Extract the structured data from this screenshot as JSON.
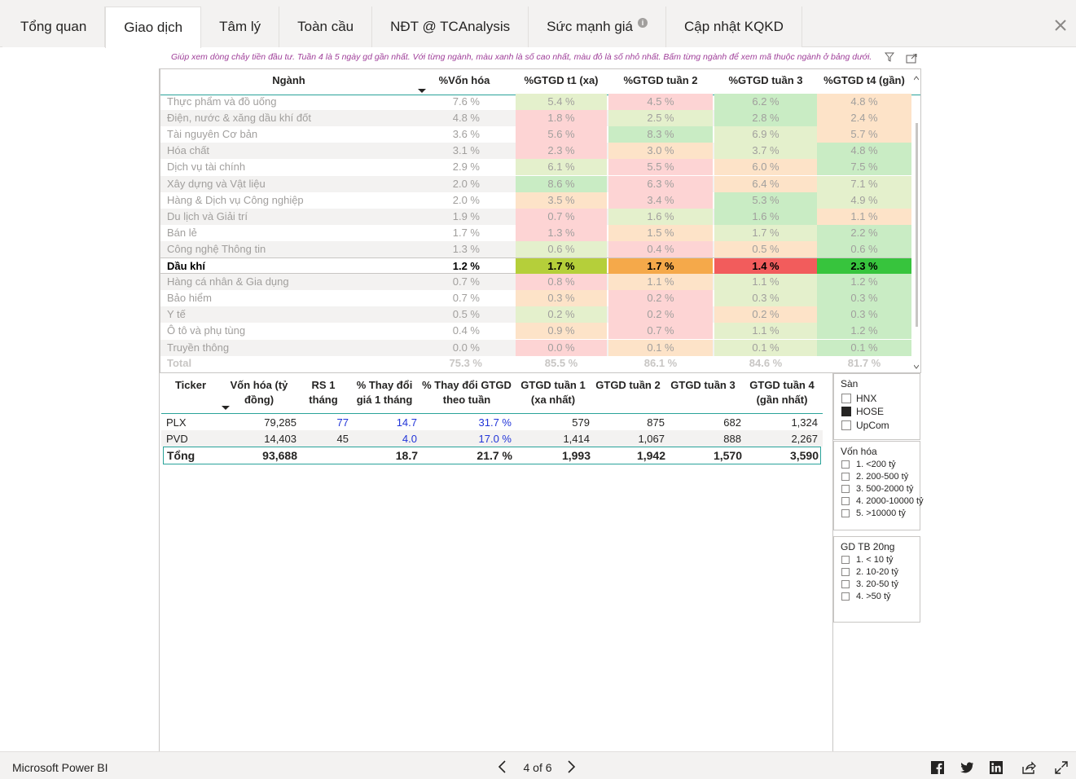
{
  "tabs": [
    {
      "label": "Tổng quan"
    },
    {
      "label": "Giao dịch"
    },
    {
      "label": "Tâm lý"
    },
    {
      "label": "Toàn cầu"
    },
    {
      "label": "NĐT @ TCAnalysis"
    },
    {
      "label": "Sức mạnh giá"
    },
    {
      "label": "Cập nhật KQKD"
    }
  ],
  "active_tab": "Giao dịch",
  "note": "Giúp xem dòng chảy tiền đầu tư. Tuần 4 là 5 ngày gd gần nhất. Với từng ngành, màu xanh là số cao nhất, màu đỏ là số nhỏ nhất. Bấm từng ngành để xem mã thuộc ngành ở bảng dưới.",
  "sector_table": {
    "headers": [
      "Ngành",
      "%Vốn hóa",
      "%GTGD t1 (xa)",
      "%GTGD tuần 2",
      "%GTGD tuần 3",
      "%GTGD t4 (gần)"
    ],
    "rows": [
      {
        "name": "Thực phẩm và đồ uống",
        "cap": "7.6 %",
        "w": [
          "5.4 %",
          "4.5 %",
          "6.2 %",
          "4.8 %"
        ],
        "c": [
          "#e4f0cc",
          "#fdd4d4",
          "#c9ecc4",
          "#fde3c8"
        ]
      },
      {
        "name": "Điện, nước & xăng dầu khí đốt",
        "cap": "4.8 %",
        "w": [
          "1.8 %",
          "2.5 %",
          "2.8 %",
          "2.4 %"
        ],
        "c": [
          "#fdd4d4",
          "#e4f0cc",
          "#c9ecc4",
          "#fde3c8"
        ]
      },
      {
        "name": "Tài nguyên Cơ bản",
        "cap": "3.6 %",
        "w": [
          "5.6 %",
          "8.3 %",
          "6.9 %",
          "5.7 %"
        ],
        "c": [
          "#fdd4d4",
          "#c9ecc4",
          "#e4f0cc",
          "#fde3c8"
        ]
      },
      {
        "name": "Hóa chất",
        "cap": "3.1 %",
        "w": [
          "2.3 %",
          "3.0 %",
          "3.7 %",
          "4.8 %"
        ],
        "c": [
          "#fdd4d4",
          "#fde3c8",
          "#e4f0cc",
          "#c9ecc4"
        ]
      },
      {
        "name": "Dịch vụ tài chính",
        "cap": "2.9 %",
        "w": [
          "6.1 %",
          "5.5 %",
          "6.0 %",
          "7.5 %"
        ],
        "c": [
          "#e4f0cc",
          "#fdd4d4",
          "#fde3c8",
          "#c9ecc4"
        ]
      },
      {
        "name": "Xây dựng và Vật liệu",
        "cap": "2.0 %",
        "w": [
          "8.6 %",
          "6.3 %",
          "6.4 %",
          "7.1 %"
        ],
        "c": [
          "#c9ecc4",
          "#fdd4d4",
          "#fde3c8",
          "#e4f0cc"
        ]
      },
      {
        "name": "Hàng & Dịch vụ Công nghiệp",
        "cap": "2.0 %",
        "w": [
          "3.5 %",
          "3.4 %",
          "5.3 %",
          "4.9 %"
        ],
        "c": [
          "#fde3c8",
          "#fdd4d4",
          "#c9ecc4",
          "#e4f0cc"
        ]
      },
      {
        "name": "Du lịch và Giải trí",
        "cap": "1.9 %",
        "w": [
          "0.7 %",
          "1.6 %",
          "1.6 %",
          "1.1 %"
        ],
        "c": [
          "#fdd4d4",
          "#e4f0cc",
          "#c9ecc4",
          "#fde3c8"
        ]
      },
      {
        "name": "Bán lẻ",
        "cap": "1.7 %",
        "w": [
          "1.3 %",
          "1.5 %",
          "1.7 %",
          "2.2 %"
        ],
        "c": [
          "#fdd4d4",
          "#fde3c8",
          "#e4f0cc",
          "#c9ecc4"
        ]
      },
      {
        "name": "Công nghệ Thông tin",
        "cap": "1.3 %",
        "w": [
          "0.6 %",
          "0.4 %",
          "0.5 %",
          "0.6 %"
        ],
        "c": [
          "#e4f0cc",
          "#fdd4d4",
          "#fde3c8",
          "#c9ecc4"
        ]
      },
      {
        "name": "Dầu khí",
        "cap": "1.2 %",
        "w": [
          "1.7 %",
          "1.7 %",
          "1.4 %",
          "2.3 %"
        ],
        "c": [
          "#b5cf3a",
          "#f5a94a",
          "#f25c5c",
          "#37c43d"
        ],
        "highlight": true
      },
      {
        "name": "Hàng cá nhân & Gia dụng",
        "cap": "0.7 %",
        "w": [
          "0.8 %",
          "1.1 %",
          "1.1 %",
          "1.2 %"
        ],
        "c": [
          "#fdd4d4",
          "#fde3c8",
          "#e4f0cc",
          "#c9ecc4"
        ]
      },
      {
        "name": "Bảo hiểm",
        "cap": "0.7 %",
        "w": [
          "0.3 %",
          "0.2 %",
          "0.3 %",
          "0.3 %"
        ],
        "c": [
          "#fde3c8",
          "#fdd4d4",
          "#e4f0cc",
          "#c9ecc4"
        ]
      },
      {
        "name": "Y tế",
        "cap": "0.5 %",
        "w": [
          "0.2 %",
          "0.2 %",
          "0.2 %",
          "0.3 %"
        ],
        "c": [
          "#e4f0cc",
          "#fdd4d4",
          "#fde3c8",
          "#c9ecc4"
        ]
      },
      {
        "name": "Ô tô và phụ tùng",
        "cap": "0.4 %",
        "w": [
          "0.9 %",
          "0.7 %",
          "1.1 %",
          "1.2 %"
        ],
        "c": [
          "#fde3c8",
          "#fdd4d4",
          "#e4f0cc",
          "#c9ecc4"
        ]
      },
      {
        "name": "Truyền thông",
        "cap": "0.0 %",
        "w": [
          "0.0 %",
          "0.1 %",
          "0.1 %",
          "0.1 %"
        ],
        "c": [
          "#fdd4d4",
          "#fde3c8",
          "#e4f0cc",
          "#c9ecc4"
        ]
      }
    ],
    "total": {
      "label": "Total",
      "cap": "75.3 %",
      "w": [
        "85.5 %",
        "86.1 %",
        "84.6 %",
        "81.7 %"
      ]
    }
  },
  "ticker_table": {
    "headers": [
      "Ticker",
      "Vốn hóa (tỷ đồng)",
      "RS 1 tháng",
      "% Thay đổi giá 1 tháng",
      "% Thay đổi GTGD theo tuần",
      "GTGD tuần 1 (xa nhất)",
      "GTGD tuần 2",
      "GTGD tuần 3",
      "GTGD tuần 4 (gần nhất)"
    ],
    "rows": [
      {
        "ticker": "PLX",
        "cap": "79,285",
        "rs": "77",
        "price_chg": "14.7",
        "gtgd_chg": "31.7 %",
        "w1": "579",
        "w2": "875",
        "w3": "682",
        "w4": "1,324"
      },
      {
        "ticker": "PVD",
        "cap": "14,403",
        "rs": "45",
        "price_chg": "4.0",
        "gtgd_chg": "17.0 %",
        "w1": "1,414",
        "w2": "1,067",
        "w3": "888",
        "w4": "2,267"
      }
    ],
    "total": {
      "label": "Tổng",
      "cap": "93,688",
      "rs": "",
      "price_chg": "18.7",
      "gtgd_chg": "21.7 %",
      "w1": "1,993",
      "w2": "1,942",
      "w3": "1,570",
      "w4": "3,590"
    }
  },
  "slicers": {
    "san": {
      "title": "Sàn",
      "options": [
        {
          "label": "HNX",
          "checked": false
        },
        {
          "label": "HOSE",
          "checked": true
        },
        {
          "label": "UpCom",
          "checked": false
        }
      ]
    },
    "von_hoa": {
      "title": "Vốn hóa",
      "options": [
        {
          "label": "1. <200 tỷ",
          "checked": false
        },
        {
          "label": "2. 200-500 tỷ",
          "checked": false
        },
        {
          "label": "3. 500-2000 tỷ",
          "checked": false
        },
        {
          "label": "4. 2000-10000 tỷ",
          "checked": false
        },
        {
          "label": "5. >10000 tỷ",
          "checked": false
        }
      ]
    },
    "gd_tb": {
      "title": "GD TB 20ng",
      "options": [
        {
          "label": "1. < 10 tỷ",
          "checked": false
        },
        {
          "label": "2. 10-20 tỷ",
          "checked": false
        },
        {
          "label": "3. 20-50 tỷ",
          "checked": false
        },
        {
          "label": "4. >50 tỷ",
          "checked": false
        }
      ]
    }
  },
  "footer": {
    "brand": "Microsoft Power BI",
    "page_label": "4 of 6"
  },
  "icons": {
    "close": "close-icon",
    "info": "info-icon",
    "focus": "focus-mode-icon",
    "filter": "filter-icon",
    "share": [
      "facebook-icon",
      "twitter-icon",
      "linkedin-icon",
      "share-icon",
      "fullscreen-icon"
    ]
  },
  "colors": {
    "accent_teal": "#2aa39a",
    "note_purple": "#a0409a",
    "blue_value": "#2235d8"
  }
}
